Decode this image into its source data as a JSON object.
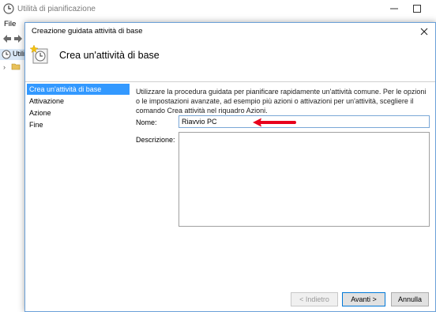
{
  "app": {
    "title": "Utilità di pianificazione",
    "menu": {
      "file": "File"
    },
    "tree": {
      "item_label": "Utili"
    }
  },
  "dialog": {
    "title": "Creazione guidata attività di base",
    "header_title": "Crea un'attività di base",
    "steps": [
      {
        "label": "Crea un'attività di base",
        "active": true
      },
      {
        "label": "Attivazione",
        "active": false
      },
      {
        "label": "Azione",
        "active": false
      },
      {
        "label": "Fine",
        "active": false
      }
    ],
    "description": "Utilizzare la procedura guidata per pianificare rapidamente un'attività comune. Per le opzioni o le impostazioni avanzate, ad esempio più azioni o attivazioni per un'attività, scegliere il comando Crea attività nel riquadro Azioni.",
    "name_label": "Nome:",
    "name_value": "Riavvio PC",
    "description_label": "Descrizione:",
    "description_value": "",
    "buttons": {
      "back": "< Indietro",
      "next": "Avanti >",
      "cancel": "Annulla"
    }
  },
  "colors": {
    "accent": "#3399ff",
    "annotation_arrow": "#e8001c",
    "dialog_border": "#6aa0d8"
  },
  "icons": {
    "app": "clock-icon",
    "header": "task-wizard-icon",
    "annotation": "red-arrow-annotation"
  }
}
